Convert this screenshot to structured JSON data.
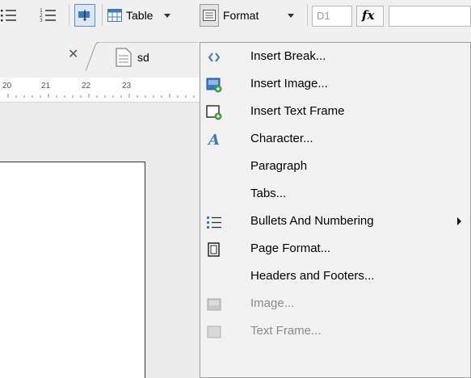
{
  "toolbar": {
    "table_label": "Table",
    "format_label": "Format",
    "cell_ref": "D1",
    "fx_label": "fx",
    "formula_value": ""
  },
  "tabs": [
    {
      "label": ""
    },
    {
      "label": "sd"
    }
  ],
  "ruler": {
    "ticks": [
      "20",
      "21",
      "22",
      "23"
    ]
  },
  "menu": {
    "items": [
      {
        "label": "Insert Break...",
        "icon": "insert-break-icon",
        "enabled": true
      },
      {
        "label": "Insert Image...",
        "icon": "insert-image-icon",
        "enabled": true
      },
      {
        "label": "Insert Text Frame",
        "icon": "insert-text-frame-icon",
        "enabled": true
      },
      {
        "label": "Character...",
        "icon": "character-icon",
        "enabled": true
      },
      {
        "label": "Paragraph",
        "icon": "",
        "enabled": true
      },
      {
        "label": "Tabs...",
        "icon": "",
        "enabled": true
      },
      {
        "label": "Bullets And Numbering",
        "icon": "bullets-icon",
        "enabled": true,
        "submenu": true
      },
      {
        "label": "Page Format...",
        "icon": "page-format-icon",
        "enabled": true
      },
      {
        "label": "Headers and Footers...",
        "icon": "",
        "enabled": true
      },
      {
        "label": "Image...",
        "icon": "image-icon",
        "enabled": false
      },
      {
        "label": "Text Frame...",
        "icon": "text-frame-icon",
        "enabled": false
      }
    ]
  },
  "colors": {
    "accent": "#3a78c8",
    "menu_bg": "#f2f2f2",
    "disabled_text": "#8a8a8a"
  }
}
